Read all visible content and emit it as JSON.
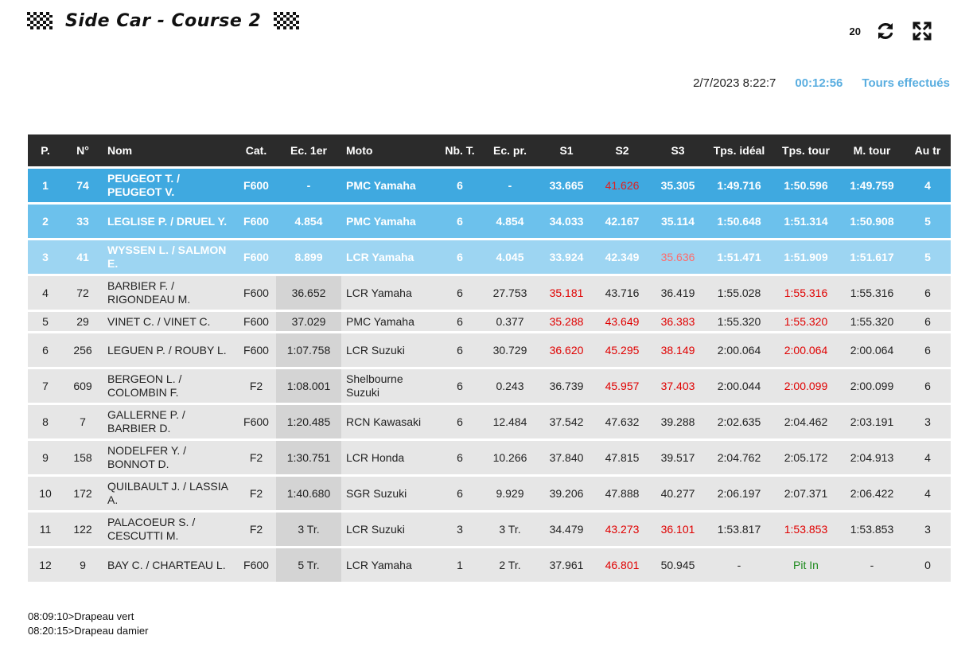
{
  "header": {
    "title": "Side Car - Course 2",
    "flag_icon": "checkered-flag-icon"
  },
  "controls": {
    "refresh_count": "20",
    "refresh_icon": "refresh-icon",
    "fullscreen_icon": "fullscreen-icon"
  },
  "status": {
    "datetime": "2/7/2023 8:22:7",
    "elapsed": "00:12:56",
    "tours_link": "Tours effectués"
  },
  "colors": {
    "accent": "#3fa9e0",
    "header_bg": "#2b2b2b",
    "best": "#e00000",
    "pit": "#1d8a1d"
  },
  "table": {
    "columns": [
      "P.",
      "N°",
      "Nom",
      "Cat.",
      "Ec. 1er",
      "Moto",
      "Nb. T.",
      "Ec. pr.",
      "S1",
      "S2",
      "S3",
      "Tps. idéal",
      "Tps. tour",
      "M. tour",
      "Au tr"
    ],
    "rows": [
      {
        "p": "1",
        "num": "74",
        "nom": "PEUGEOT T. / PEUGEOT V.",
        "cat": "F600",
        "ec1": "-",
        "moto": "PMC Yamaha",
        "nbt": "6",
        "ecpr": "-",
        "s1": "33.665",
        "s2": "41.626",
        "s3": "35.305",
        "ideal": "1:49.716",
        "tour": "1:50.596",
        "mtour": "1:49.759",
        "autr": "4"
      },
      {
        "p": "2",
        "num": "33",
        "nom": "LEGLISE P. / DRUEL Y.",
        "cat": "F600",
        "ec1": "4.854",
        "moto": "PMC Yamaha",
        "nbt": "6",
        "ecpr": "4.854",
        "s1": "34.033",
        "s2": "42.167",
        "s3": "35.114",
        "ideal": "1:50.648",
        "tour": "1:51.314",
        "mtour": "1:50.908",
        "autr": "5"
      },
      {
        "p": "3",
        "num": "41",
        "nom": "WYSSEN L. / SALMON E.",
        "cat": "F600",
        "ec1": "8.899",
        "moto": "LCR Yamaha",
        "nbt": "6",
        "ecpr": "4.045",
        "s1": "33.924",
        "s2": "42.349",
        "s3": "35.636",
        "ideal": "1:51.471",
        "tour": "1:51.909",
        "mtour": "1:51.617",
        "autr": "5"
      },
      {
        "p": "4",
        "num": "72",
        "nom": "BARBIER F. / RIGONDEAU M.",
        "cat": "F600",
        "ec1": "36.652",
        "moto": "LCR Yamaha",
        "nbt": "6",
        "ecpr": "27.753",
        "s1": "35.181",
        "s2": "43.716",
        "s3": "36.419",
        "ideal": "1:55.028",
        "tour": "1:55.316",
        "mtour": "1:55.316",
        "autr": "6"
      },
      {
        "p": "5",
        "num": "29",
        "nom": "VINET C. / VINET C.",
        "cat": "F600",
        "ec1": "37.029",
        "moto": "PMC Yamaha",
        "nbt": "6",
        "ecpr": "0.377",
        "s1": "35.288",
        "s2": "43.649",
        "s3": "36.383",
        "ideal": "1:55.320",
        "tour": "1:55.320",
        "mtour": "1:55.320",
        "autr": "6"
      },
      {
        "p": "6",
        "num": "256",
        "nom": "LEGUEN P. / ROUBY L.",
        "cat": "F600",
        "ec1": "1:07.758",
        "moto": "LCR Suzuki",
        "nbt": "6",
        "ecpr": "30.729",
        "s1": "36.620",
        "s2": "45.295",
        "s3": "38.149",
        "ideal": "2:00.064",
        "tour": "2:00.064",
        "mtour": "2:00.064",
        "autr": "6"
      },
      {
        "p": "7",
        "num": "609",
        "nom": "BERGEON L. / COLOMBIN F.",
        "cat": "F2",
        "ec1": "1:08.001",
        "moto": "Shelbourne Suzuki",
        "nbt": "6",
        "ecpr": "0.243",
        "s1": "36.739",
        "s2": "45.957",
        "s3": "37.403",
        "ideal": "2:00.044",
        "tour": "2:00.099",
        "mtour": "2:00.099",
        "autr": "6"
      },
      {
        "p": "8",
        "num": "7",
        "nom": "GALLERNE P. / BARBIER D.",
        "cat": "F600",
        "ec1": "1:20.485",
        "moto": "RCN Kawasaki",
        "nbt": "6",
        "ecpr": "12.484",
        "s1": "37.542",
        "s2": "47.632",
        "s3": "39.288",
        "ideal": "2:02.635",
        "tour": "2:04.462",
        "mtour": "2:03.191",
        "autr": "3"
      },
      {
        "p": "9",
        "num": "158",
        "nom": "NODELFER Y. / BONNOT D.",
        "cat": "F2",
        "ec1": "1:30.751",
        "moto": "LCR Honda",
        "nbt": "6",
        "ecpr": "10.266",
        "s1": "37.840",
        "s2": "47.815",
        "s3": "39.517",
        "ideal": "2:04.762",
        "tour": "2:05.172",
        "mtour": "2:04.913",
        "autr": "4"
      },
      {
        "p": "10",
        "num": "172",
        "nom": "QUILBAULT J. / LASSIA A.",
        "cat": "F2",
        "ec1": "1:40.680",
        "moto": "SGR Suzuki",
        "nbt": "6",
        "ecpr": "9.929",
        "s1": "39.206",
        "s2": "47.888",
        "s3": "40.277",
        "ideal": "2:06.197",
        "tour": "2:07.371",
        "mtour": "2:06.422",
        "autr": "4"
      },
      {
        "p": "11",
        "num": "122",
        "nom": "PALACOEUR S. / CESCUTTI M.",
        "cat": "F2",
        "ec1": "3 Tr.",
        "moto": "LCR Suzuki",
        "nbt": "3",
        "ecpr": "3 Tr.",
        "s1": "34.479",
        "s2": "43.273",
        "s3": "36.101",
        "ideal": "1:53.817",
        "tour": "1:53.853",
        "mtour": "1:53.853",
        "autr": "3"
      },
      {
        "p": "12",
        "num": "9",
        "nom": "BAY C. / CHARTEAU L.",
        "cat": "F600",
        "ec1": "5 Tr.",
        "moto": "LCR Yamaha",
        "nbt": "1",
        "ecpr": "2 Tr.",
        "s1": "37.961",
        "s2": "46.801",
        "s3": "50.945",
        "ideal": "-",
        "tour": "Pit In",
        "mtour": "-",
        "autr": "0"
      }
    ]
  },
  "log": [
    "08:09:10>Drapeau vert",
    "08:20:15>Drapeau damier"
  ]
}
